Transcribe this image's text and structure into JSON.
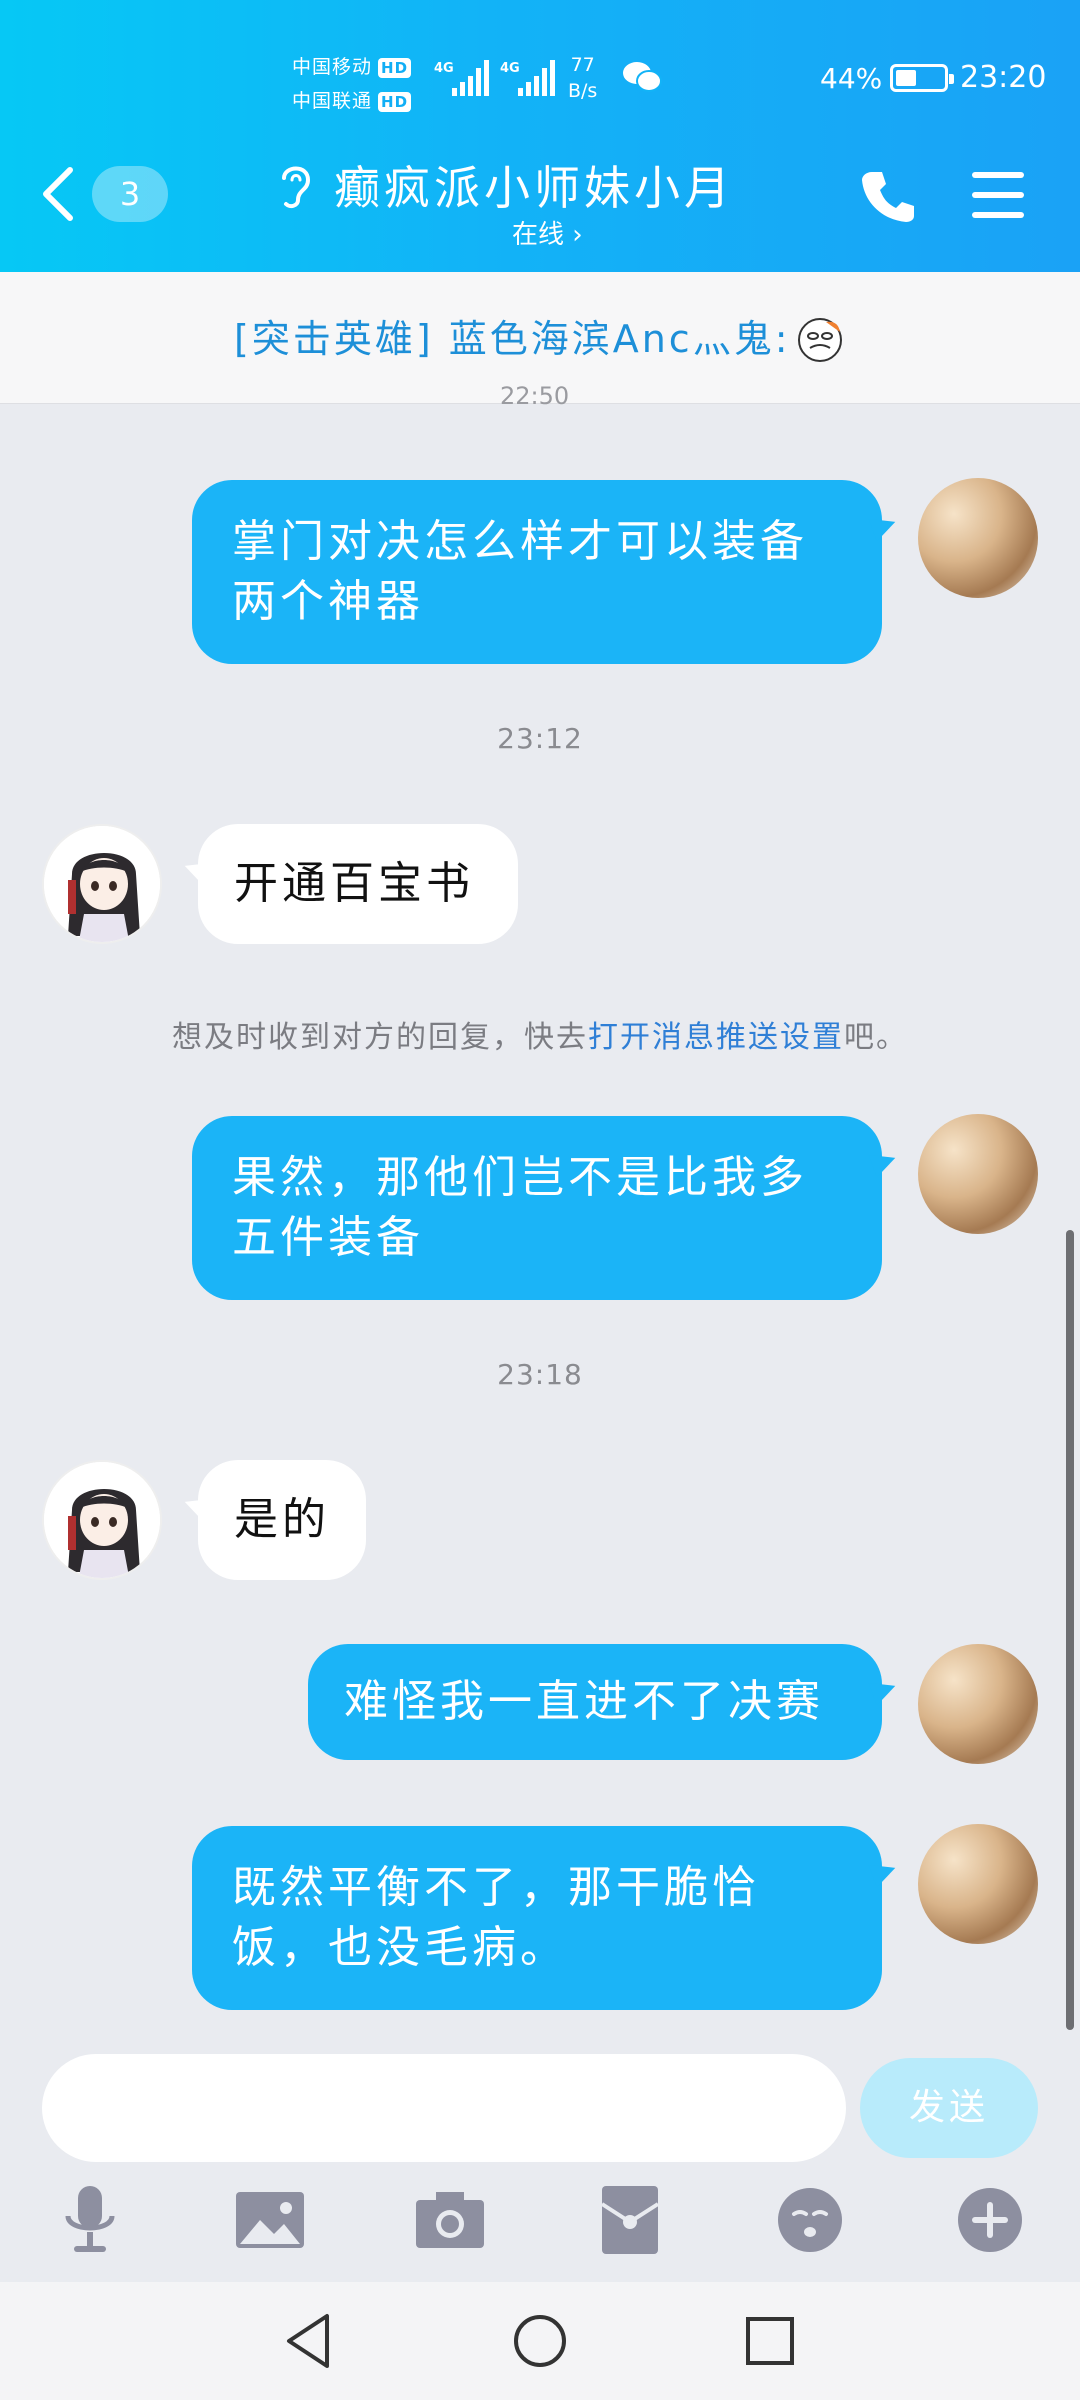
{
  "status_bar": {
    "carrier_1": "中国移动",
    "carrier_2": "中国联通",
    "hd": "HD",
    "net_type": "4G",
    "net_speed_value": "77",
    "net_speed_unit": "B/s",
    "battery_percent": "44%",
    "battery_level": 0.44,
    "time": "23:20"
  },
  "header": {
    "unread_count": "3",
    "title": "癫疯派小师妹小月",
    "status": "在线 ›",
    "accent_color": "#12b3f7"
  },
  "announcement": {
    "text": "[突击英雄] 蓝色海滨Anc灬鬼:"
  },
  "messages": {
    "partial_time": "22:50",
    "msg1": {
      "side": "out",
      "text_line1": "掌门对决怎么样才可以装备",
      "text_line2": "两个神器"
    },
    "time1": "23:12",
    "msg2": {
      "side": "in",
      "text": "开通百宝书"
    },
    "tip": {
      "prefix": "想及时收到对方的回复，快去",
      "link": "打开消息推送设置",
      "suffix": "吧。"
    },
    "msg3": {
      "side": "out",
      "text_line1": "果然，那他们岂不是比我多",
      "text_line2": "五件装备"
    },
    "time2": "23:18",
    "msg4": {
      "side": "in",
      "text": "是的"
    },
    "msg5": {
      "side": "out",
      "text": "难怪我一直进不了决赛"
    },
    "msg6": {
      "side": "out",
      "text_line1": "既然平衡不了，那干脆恰",
      "text_line2": "饭，也没毛病。"
    }
  },
  "input": {
    "value": "",
    "send_label": "发送"
  },
  "toolbar": [
    "microphone-icon",
    "image-icon",
    "camera-icon",
    "red-packet-icon",
    "emoji-icon",
    "plus-icon"
  ],
  "nav": [
    "back-triangle-icon",
    "home-circle-icon",
    "recents-square-icon"
  ]
}
